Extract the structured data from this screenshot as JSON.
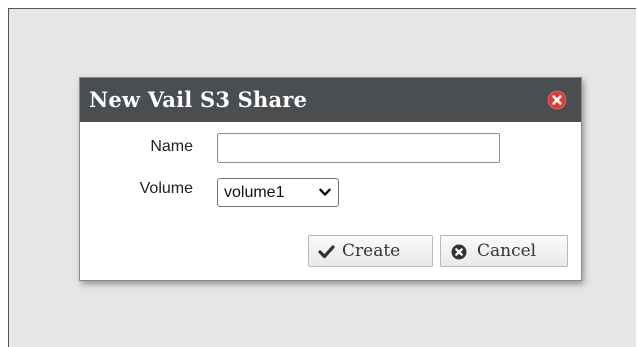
{
  "dialog": {
    "title": "New Vail S3 Share",
    "close_icon": "close-circle-icon",
    "close_color": "#e03c31"
  },
  "form": {
    "name_label": "Name",
    "name_value": "",
    "name_placeholder": "",
    "volume_label": "Volume",
    "volume_selected": "volume1",
    "volume_options": [
      "volume1"
    ]
  },
  "buttons": {
    "create_label": "Create",
    "create_icon": "checkmark-icon",
    "cancel_label": "Cancel",
    "cancel_icon": "cancel-circle-icon"
  },
  "colors": {
    "titlebar": "#4a4e51",
    "backdrop": "#e6e6e6"
  }
}
